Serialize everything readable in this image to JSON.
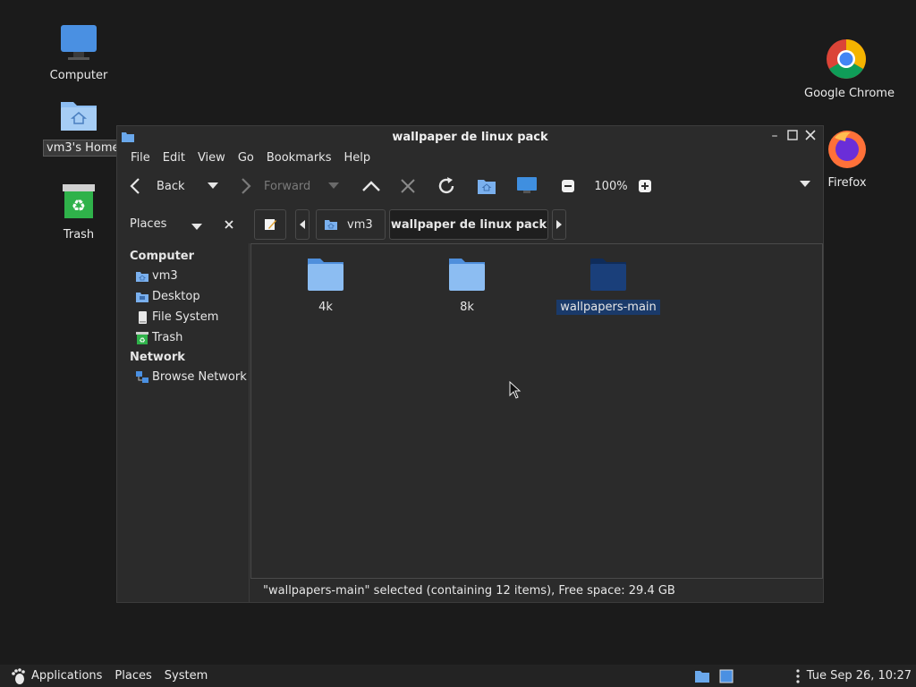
{
  "desktop": {
    "icons": [
      {
        "label": "Computer"
      },
      {
        "label": "vm3's Home"
      },
      {
        "label": "Trash"
      },
      {
        "label": "Google Chrome"
      },
      {
        "label": "Firefox"
      }
    ]
  },
  "window": {
    "title": "wallpaper de linux pack",
    "menu": [
      "File",
      "Edit",
      "View",
      "Go",
      "Bookmarks",
      "Help"
    ],
    "toolbar": {
      "back": "Back",
      "forward": "Forward",
      "zoom": "100%"
    },
    "location": {
      "places_label": "Places",
      "crumbs": [
        "vm3",
        "wallpaper de linux pack"
      ]
    },
    "sidebar": {
      "sections": [
        {
          "heading": "Computer",
          "items": [
            "vm3",
            "Desktop",
            "File System",
            "Trash"
          ]
        },
        {
          "heading": "Network",
          "items": [
            "Browse Network"
          ]
        }
      ]
    },
    "files": [
      {
        "name": "4k"
      },
      {
        "name": "8k"
      },
      {
        "name": "wallpapers-main"
      }
    ],
    "status": "\"wallpapers-main\" selected (containing 12 items), Free space: 29.4 GB"
  },
  "taskbar": {
    "menus": [
      "Applications",
      "Places",
      "System"
    ],
    "clock": "Tue Sep 26, 10:27"
  },
  "colors": {
    "folder": "#6aa8ec",
    "folder_selected": "#1a3f7a",
    "selection": "#1a3a6a"
  }
}
